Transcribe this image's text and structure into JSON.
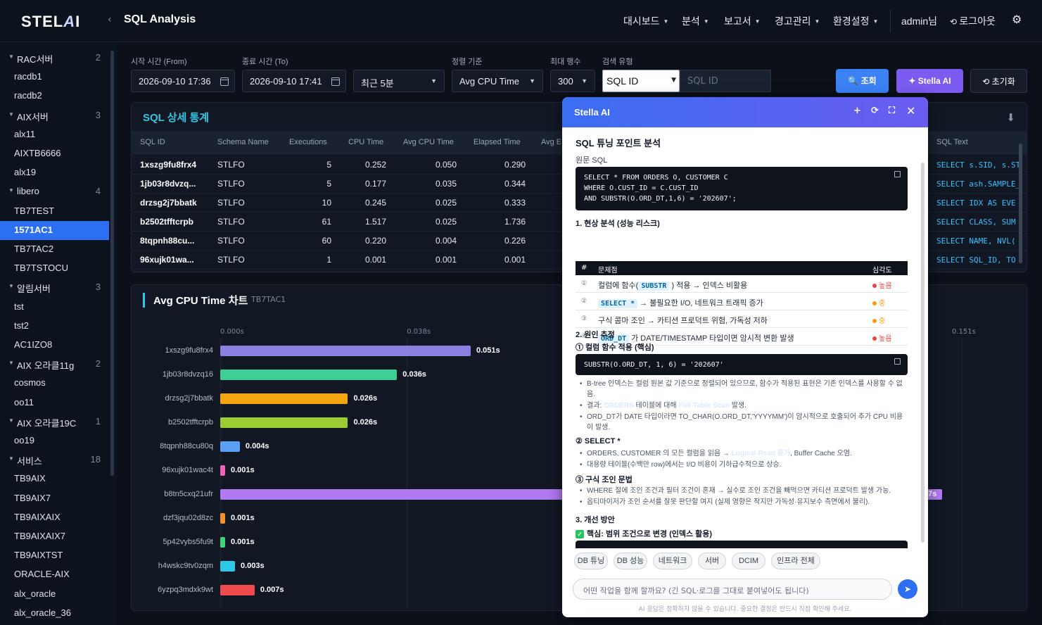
{
  "header": {
    "logo": "STELLA",
    "logo_a": "A",
    "logo_rest": "I",
    "back": "‹",
    "title": "SQL Analysis",
    "nav": [
      "대시보드",
      "분석",
      "보고서",
      "경고관리",
      "환경설정"
    ],
    "user": "admin님",
    "logout": "로그아웃"
  },
  "sidebar": [
    {
      "type": "group",
      "name": "RAC서버",
      "count": "2"
    },
    {
      "type": "item",
      "name": "racdb1"
    },
    {
      "type": "item",
      "name": "racdb2"
    },
    {
      "type": "group",
      "name": "AIX서버",
      "count": "3"
    },
    {
      "type": "item",
      "name": "alx11"
    },
    {
      "type": "item",
      "name": "AIXTB6666"
    },
    {
      "type": "item",
      "name": "alx19"
    },
    {
      "type": "group",
      "name": "libero",
      "count": "4"
    },
    {
      "type": "item",
      "name": "TB7TEST"
    },
    {
      "type": "item",
      "name": "1571AC1",
      "active": true
    },
    {
      "type": "item",
      "name": "TB7TAC2"
    },
    {
      "type": "item",
      "name": "TB7TSTOCU"
    },
    {
      "type": "group",
      "name": "알림서버",
      "count": "3"
    },
    {
      "type": "item",
      "name": "tst"
    },
    {
      "type": "item",
      "name": "tst2"
    },
    {
      "type": "item",
      "name": "AC1IZO8"
    },
    {
      "type": "group",
      "name": "AIX 오라클11g",
      "count": "2"
    },
    {
      "type": "item",
      "name": "cosmos"
    },
    {
      "type": "item",
      "name": "oo11"
    },
    {
      "type": "group",
      "name": "AIX 오라클19C",
      "count": "1"
    },
    {
      "type": "item",
      "name": "oo19"
    },
    {
      "type": "group",
      "name": "서비스",
      "count": "18"
    },
    {
      "type": "item",
      "name": "TB9AIX"
    },
    {
      "type": "item",
      "name": "TB9AIX7"
    },
    {
      "type": "item",
      "name": "TB9AIXAIX"
    },
    {
      "type": "item",
      "name": "TB9AIXAIX7"
    },
    {
      "type": "item",
      "name": "TB9AIXTST"
    },
    {
      "type": "item",
      "name": "ORACLE-AIX"
    },
    {
      "type": "item",
      "name": "alx_oracle"
    },
    {
      "type": "item",
      "name": "alx_oracle_36"
    }
  ],
  "filters": {
    "from_label": "시작 시간 (From)",
    "from": "2026-09-10 17:36",
    "to_label": "종료 시간 (To)",
    "to": "2026-09-10 17:41",
    "range": "최근 5분",
    "sort_label": "정렬 기준",
    "sort": "Avg CPU Time",
    "max_label": "최대 행수",
    "max": "300",
    "search_label": "검색 유형",
    "search_type": "SQL ID",
    "search_placeholder": "SQL ID",
    "btn_search": "조회",
    "btn_ai": "Stella AI",
    "btn_reset": "초기화"
  },
  "stats": {
    "title": "SQL 상세 통계",
    "columns": [
      "SQL ID",
      "Schema Name",
      "Executions",
      "CPU Time",
      "Avg CPU Time",
      "Elapsed Time",
      "Avg E",
      "SQL Text"
    ],
    "rows": [
      [
        "1xszg9fu8frx4",
        "STLFO",
        "5",
        "0.252",
        "0.050",
        "0.290",
        "SELECT s.SID, s.ST"
      ],
      [
        "1jb03r8dvzq...",
        "STLFO",
        "5",
        "0.177",
        "0.035",
        "0.344",
        "SELECT ash.SAMPLE_"
      ],
      [
        "drzsg2j7bbatk",
        "STLFO",
        "10",
        "0.245",
        "0.025",
        "0.333",
        "SELECT IDX AS EVE"
      ],
      [
        "b2502tfftcrpb",
        "STLFO",
        "61",
        "1.517",
        "0.025",
        "1.736",
        "SELECT CLASS, SUM"
      ],
      [
        "8tqpnh88cu...",
        "STLFO",
        "60",
        "0.220",
        "0.004",
        "0.226",
        "SELECT NAME, NVL("
      ],
      [
        "96xujk01wa...",
        "STLFO",
        "1",
        "0.001",
        "0.001",
        "0.001",
        "SELECT SQL_ID, TO"
      ]
    ]
  },
  "chart_data": {
    "type": "bar",
    "title": "Avg CPU Time 차트",
    "subtitle": "TB7TAC1",
    "x_ticks": [
      "0.000s",
      "0.038s",
      "0.151s"
    ],
    "xlim": [
      0,
      0.151
    ],
    "categories": [
      "1xszg9fu8frx4",
      "1jb03r8dvzq16",
      "drzsg2j7bbatk",
      "b2502tfftcrpb",
      "8tqpnh88cu80q",
      "96xujk01wac4t",
      "b8tn5cxq21ufr",
      "dzf3jqu02d8zc",
      "5p42vybs5fu9t",
      "h4wskc9tv0zqm",
      "6yzpq3mdxk9wt"
    ],
    "values": [
      0.051,
      0.036,
      0.026,
      0.026,
      0.004,
      0.001,
      0.147,
      0.001,
      0.001,
      0.003,
      0.007
    ],
    "labels": [
      "0.051s",
      "0.036s",
      "0.026s",
      "0.026s",
      "0.004s",
      "0.001s",
      "7s",
      "0.001s",
      "0.001s",
      "0.003s",
      "0.007s"
    ],
    "colors": [
      "#8b7fe0",
      "#3ecf96",
      "#f5a60f",
      "#9acd32",
      "#5aa0f5",
      "#f062b4",
      "#b07af0",
      "#f5902a",
      "#3ed67a",
      "#2ec9e6",
      "#ee4c4c"
    ]
  },
  "stella": {
    "title": "Stella AI",
    "h_main": "SQL 튜닝 포인트 분석",
    "h_orig": "원문 SQL",
    "code1": [
      "SELECT * FROM ORDERS O, CUSTOMER C",
      "WHERE O.CUST_ID = C.CUST_ID",
      "AND SUBSTR(O.ORD_DT,1,6) = '202607';"
    ],
    "h_1": "1. 현상 분석 (성능 리스크)",
    "risk_cols": [
      "#",
      "문제점",
      "심각도"
    ],
    "risk": [
      {
        "n": "①",
        "pre": "컬럼에 함수(",
        "kw": "SUBSTR",
        "post": ") 적용 → 인덱스 비활용",
        "sev": "높음",
        "color": "#ef4444"
      },
      {
        "n": "②",
        "pre": "",
        "kw": "SELECT *",
        "post": "→ 불필요한 I/O, 네트워크 트래픽 증가",
        "sev": "중",
        "color": "#f59e0b"
      },
      {
        "n": "③",
        "pre": "구식 콤마 조인 → 카티션 프로덕트 위험, 가독성 저하",
        "kw": "",
        "post": "",
        "sev": "중",
        "color": "#f59e0b"
      },
      {
        "n": "④",
        "pre": "",
        "kw": "ORD_DT",
        "post": "가 DATE/TIMESTAMP 타입이면 암시적 변환 발생",
        "sev": "높음",
        "color": "#ef4444"
      }
    ],
    "h_2": "2. 원인 추정",
    "s_1": "① 컬럼 함수 적용 (핵심)",
    "code2": "SUBSTR(O.ORD_DT, 1, 6) = '202607'",
    "b1": "B-tree 인덱스는 컬럼 원본 값 기준으로 정렬되어 있으므로, 함수가 적용된 표현은 기존 인덱스를 사용할 수 없음.",
    "b2a": "결과: ",
    "b2k": "ORDERS",
    "b2b": " 테이블에 대해 ",
    "b2k2": "Full Table Scan",
    "b2c": " 발생.",
    "b3": "ORD_DT가 DATE 타입이라면 TO_CHAR(O.ORD_DT,'YYYYMM')이 암시적으로 호출되어 추가 CPU 비용이 발생.",
    "s_2": "② SELECT *",
    "b4a": "ORDERS, CUSTOMER 의 모든 컬럼을 읽음 → ",
    "b4k": "Logical Read 증가",
    "b4b": ", Buffer Cache 오염.",
    "b5": "대용량 테이블(수백만 row)에서는 I/O 비용이 기하급수적으로 상승.",
    "s_3": "③ 구식 조인 문법",
    "b6": "WHERE 절에 조인 조건과 필터 조건이 혼재 → 실수로 조인 조건을 빼먹으면 카티션 프로덕트 발생 가능.",
    "b7": "옵티마이저가 조인 순서를 잘못 판단할 여지 (실제 영향은 작지만 가독성·유지보수 측면에서 불리).",
    "h_3": "3. 개선 방안",
    "s_4": "핵심: 범위 조건으로 변경 (인덱스 활용)",
    "chips": [
      "DB 튜닝",
      "DB 성능",
      "네트워크",
      "서버",
      "DCIM",
      "인프라 전체"
    ],
    "input_placeholder": "어떤 작업을 함께 할까요? (긴 SQL·로그를 그대로 붙여넣어도 됩니다)",
    "footer": "AI 응답은 정확하지 않을 수 있습니다. 중요한 결정은 반드시 직접 확인해 주세요."
  }
}
